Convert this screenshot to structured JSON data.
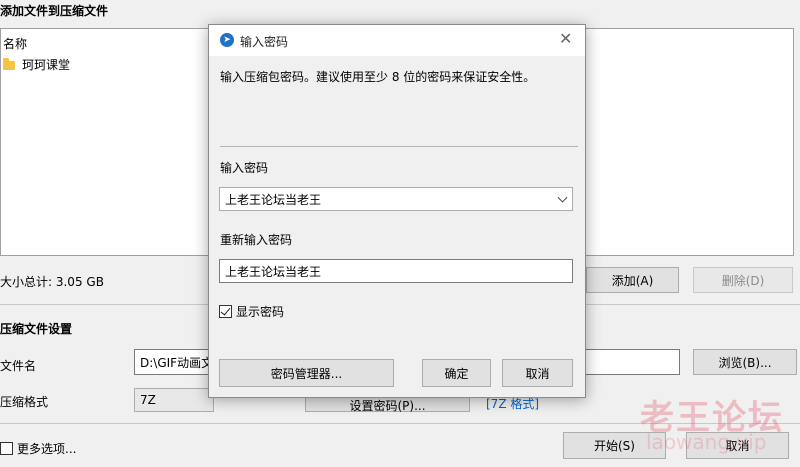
{
  "main": {
    "title": "添加文件到压缩文件",
    "list": {
      "column_header": "名称",
      "items": [
        {
          "name": "珂珂课堂",
          "icon": "folder-icon"
        }
      ]
    },
    "total_size": "大小总计: 3.05 GB",
    "add_button": "添加(A)",
    "delete_button": "删除(D)",
    "settings_title": "压缩文件设置",
    "filename_label": "文件名",
    "filename_value": "D:\\GIF动画文",
    "browse_button": "浏览(B)...",
    "format_label": "压缩格式",
    "format_value": "7Z",
    "set_password_button": "设置密码(P)...",
    "format_hint": "[7Z 格式]",
    "more_options_label": "更多选项...",
    "start_button": "开始(S)",
    "cancel_button": "取消"
  },
  "dialog": {
    "title": "输入密码",
    "description": "输入压缩包密码。建议使用至少 8 位的密码来保证安全性。",
    "password_label": "输入密码",
    "password_value": "上老王论坛当老王",
    "confirm_label": "重新输入密码",
    "confirm_value": "上老王论坛当老王",
    "show_password_label": "显示密码",
    "show_password_checked": true,
    "manager_button": "密码管理器...",
    "ok_button": "确定",
    "cancel_button": "取消"
  },
  "watermark": {
    "line1": "老王论坛",
    "line2": "laowang.vip"
  },
  "colors": {
    "accent": "#1e73c8",
    "link": "#0066cc",
    "watermark": "#e85a6e"
  }
}
